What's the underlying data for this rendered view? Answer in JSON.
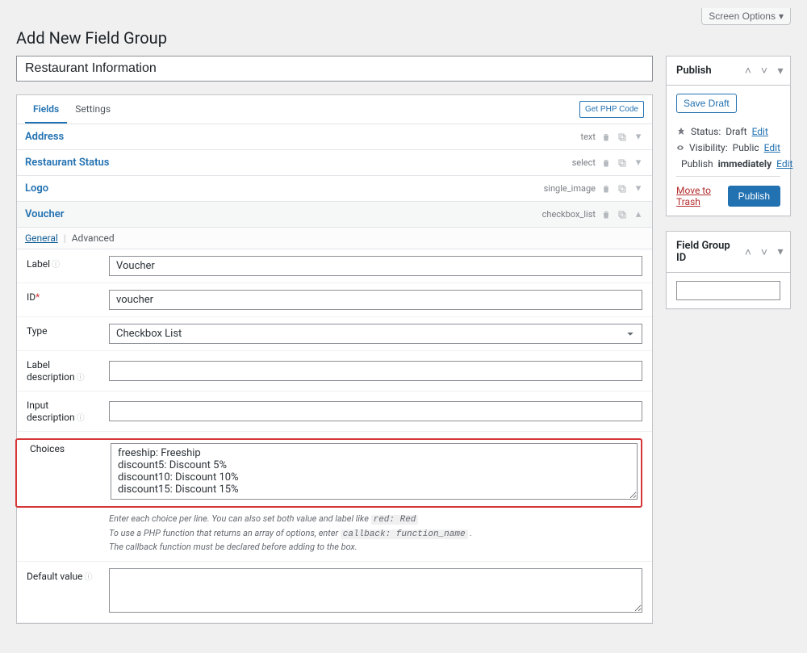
{
  "screen_options": "Screen Options",
  "page_title": "Add New Field Group",
  "group_title": "Restaurant Information",
  "tabs": {
    "fields": "Fields",
    "settings": "Settings"
  },
  "get_php": "Get PHP Code",
  "field_rows": [
    {
      "name": "Address",
      "type": "text"
    },
    {
      "name": "Restaurant Status",
      "type": "select"
    },
    {
      "name": "Logo",
      "type": "single_image"
    },
    {
      "name": "Voucher",
      "type": "checkbox_list"
    }
  ],
  "subtabs": {
    "general": "General",
    "advanced": "Advanced"
  },
  "form": {
    "label_lbl": "Label",
    "label_val": "Voucher",
    "id_lbl": "ID",
    "id_val": "voucher",
    "type_lbl": "Type",
    "type_val": "Checkbox List",
    "labeldesc_lbl": "Label description",
    "labeldesc_val": "",
    "inputdesc_lbl": "Input description",
    "inputdesc_val": "",
    "choices_lbl": "Choices",
    "choices_val": "freeship: Freeship\ndiscount5: Discount 5%\ndiscount10: Discount 10%\ndiscount15: Discount 15%",
    "hint1_a": "Enter each choice per line. You can also set both value and label like ",
    "hint1_code": "red: Red",
    "hint2_a": "To use a PHP function that returns an array of options, enter ",
    "hint2_code": "callback: function_name",
    "hint3": "The callback function must be declared before adding to the box.",
    "default_lbl": "Default value",
    "default_val": ""
  },
  "publish": {
    "title": "Publish",
    "save_draft": "Save Draft",
    "status_lbl": "Status:",
    "status_val": "Draft",
    "visibility_lbl": "Visibility:",
    "visibility_val": "Public",
    "sched_lbl": "Publish",
    "sched_val": "immediately",
    "edit": "Edit",
    "trash": "Move to Trash",
    "publish_btn": "Publish"
  },
  "fieldgroup": {
    "title": "Field Group ID",
    "value": ""
  }
}
